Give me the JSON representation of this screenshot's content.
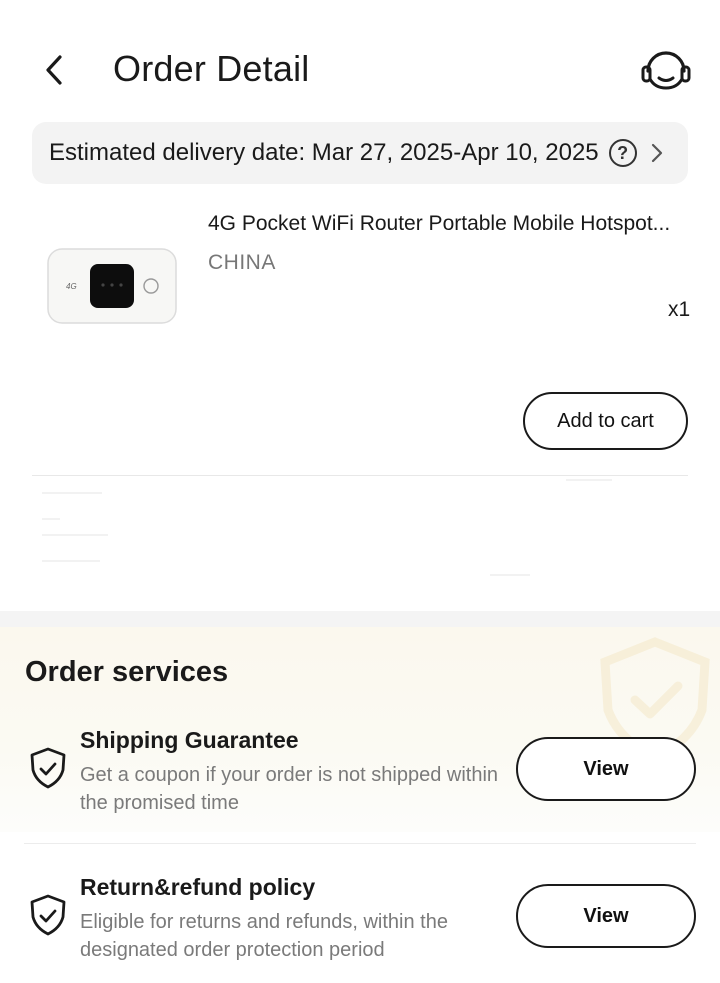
{
  "header": {
    "title": "Order Detail",
    "back_icon": "chevron-left-icon",
    "support_icon": "headset-icon"
  },
  "delivery": {
    "label": "Estimated delivery date: Mar 27, 2025-Apr 10, 2025",
    "help_glyph": "?"
  },
  "product": {
    "name": "4G Pocket WiFi Router Portable Mobile Hotspot...",
    "origin": "CHINA",
    "quantity": "x1",
    "add_to_cart_label": "Add to cart",
    "thumb_text": "4G"
  },
  "services": {
    "title": "Order services",
    "items": [
      {
        "title": "Shipping Guarantee",
        "desc": "Get a coupon if your order is not shipped within the promised time",
        "button": "View"
      },
      {
        "title": "Return&refund policy",
        "desc": "Eligible for returns and refunds, within the designated order protection period",
        "button": "View"
      }
    ]
  },
  "colors": {
    "text": "#1a1a1a",
    "muted": "#7a7a7a",
    "banner_bg": "#f3f3f3",
    "services_bg": "#fbf8ee"
  }
}
